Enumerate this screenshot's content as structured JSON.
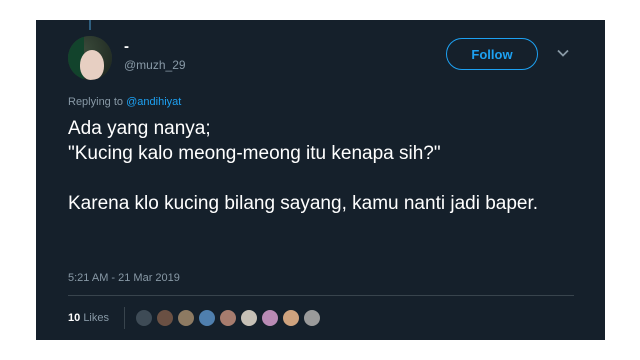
{
  "tweet": {
    "display_name": "-",
    "handle": "@muzh_29",
    "follow_label": "Follow",
    "reply_prefix": "Replying to",
    "reply_to": "@andihiyat",
    "text": "Ada yang nanya;\n\"Kucing kalo meong-meong itu kenapa sih?\"\n\nKarena klo kucing bilang sayang, kamu nanti jadi baper.",
    "timestamp": "5:21 AM - 21 Mar 2019",
    "likes_count": "10",
    "likes_label": "Likes"
  },
  "colors": {
    "background": "#15202b",
    "accent": "#1da1f2",
    "muted_text": "#8899a6",
    "liker_avatars": [
      "#3e4b56",
      "#6a5043",
      "#8d7a62",
      "#4f7fae",
      "#a77c6e",
      "#c6c0b6",
      "#b98bb5",
      "#cfa37e",
      "#9a9a9a"
    ]
  },
  "icons": {
    "menu": "chevron-down-icon"
  }
}
